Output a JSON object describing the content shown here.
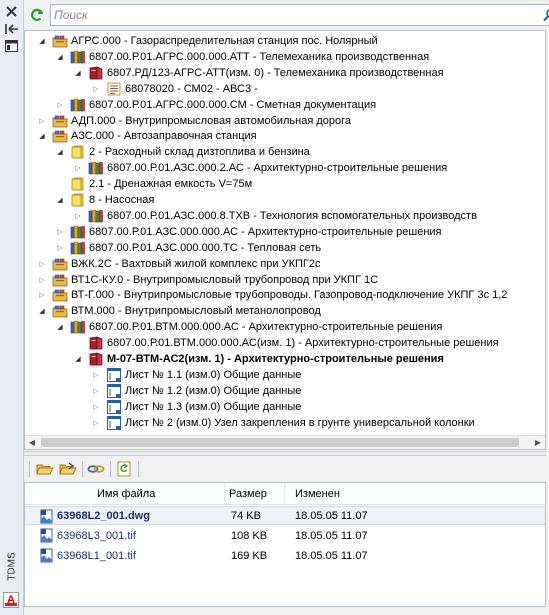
{
  "left_strip": {
    "vertical_label": "TDMS",
    "bottom_badge": "A"
  },
  "search": {
    "placeholder": "Поиск"
  },
  "tree": [
    {
      "level": 0,
      "twist": "open",
      "icon": "folder-stack-icon",
      "label": "АГРС.000 - Газораспределительная станция пос. Нолярный"
    },
    {
      "level": 1,
      "twist": "open",
      "icon": "books-icon",
      "label": "6807.00.Р.01.АГРС.000.000.АТТ - Телемеханика производственная"
    },
    {
      "level": 2,
      "twist": "open",
      "icon": "red-book-icon",
      "label": "6807.РД/123-АГРС-АТТ(изм. 0) - Телемеханика производственная"
    },
    {
      "level": 3,
      "twist": "closed",
      "icon": "doc-yellow-icon",
      "label": "68078020 - СМ02 - АВС3 -"
    },
    {
      "level": 1,
      "twist": "closed",
      "icon": "books-icon",
      "label": "6807.00.Р.01.АГРС.000.000.СМ - Сметная документация"
    },
    {
      "level": 0,
      "twist": "closed",
      "icon": "folder-stack-icon",
      "label": "АДП.000 - Внутрипромысловая автомобильная дорога"
    },
    {
      "level": 0,
      "twist": "open",
      "icon": "folder-stack-icon",
      "label": "АЗС.000 - Автозаправочная станция"
    },
    {
      "level": 1,
      "twist": "open",
      "icon": "yellow-folder-icon",
      "label": "2 - Расходный склад дизтоплива и бензина"
    },
    {
      "level": 2,
      "twist": "closed",
      "icon": "books-icon",
      "label": "6807.00.Р.01.АЗС.000.2.АС - Архитектурно-строительные решения"
    },
    {
      "level": 1,
      "twist": "none",
      "icon": "yellow-folder-icon",
      "label": "2.1 - Дренажная емкость V=75м"
    },
    {
      "level": 1,
      "twist": "open",
      "icon": "yellow-folder-icon",
      "label": "8 - Насосная"
    },
    {
      "level": 2,
      "twist": "closed",
      "icon": "books-icon",
      "label": "6807.00.Р.01.АЗС.000.8.ТХВ - Технология вспомогательных производств"
    },
    {
      "level": 1,
      "twist": "closed",
      "icon": "books-icon",
      "label": "6807.00.Р.01.АЗС.000.000.АС - Архитектурно-строительные решения"
    },
    {
      "level": 1,
      "twist": "closed",
      "icon": "books-icon",
      "label": "6807.00.Р.01.АЗС.000.000.ТС - Тепловая сеть"
    },
    {
      "level": 0,
      "twist": "closed",
      "icon": "folder-stack-icon",
      "label": "ВЖК.2С - Вахтовый жилой комплекс при УКПГ2с"
    },
    {
      "level": 0,
      "twist": "closed",
      "icon": "folder-stack-icon",
      "label": "ВТ1С-КУ.0 - Внутрипромысловый трубопровод при УКПГ 1С"
    },
    {
      "level": 0,
      "twist": "closed",
      "icon": "folder-stack-icon",
      "label": "ВТ-Г.000 - Внутрипромысловые трубопроводы. Газопровод-подключение УКПГ 3с 1,2"
    },
    {
      "level": 0,
      "twist": "open",
      "icon": "folder-stack-icon",
      "label": "ВТМ.000 - Внутрипромысловый метанолопровод"
    },
    {
      "level": 1,
      "twist": "open",
      "icon": "books-icon",
      "label": "6807.00.Р.01.ВТМ.000.000.АС - Архитектурно-строительные решения"
    },
    {
      "level": 2,
      "twist": "none",
      "icon": "red-book-icon",
      "label": "6807.00.Р.01.ВТМ.000.000.АС(изм. 1) - Архитектурно-строительные решения"
    },
    {
      "level": 2,
      "twist": "open",
      "icon": "red-book-icon",
      "label": "М-07-ВТМ-АС2(изм. 1) - Архитектурно-строительные решения",
      "selected": true
    },
    {
      "level": 3,
      "twist": "closed",
      "icon": "blue-sheet-icon",
      "label": "Лист № 1.1 (изм.0) Общие данные"
    },
    {
      "level": 3,
      "twist": "closed",
      "icon": "blue-sheet-icon",
      "label": "Лист № 1.2 (изм.0) Общие данные"
    },
    {
      "level": 3,
      "twist": "closed",
      "icon": "blue-sheet-icon",
      "label": "Лист № 1.3 (изм.0) Общие данные"
    },
    {
      "level": 3,
      "twist": "closed",
      "icon": "blue-sheet-icon",
      "label": "Лист № 2 (изм.0) Узел закрепления в грунте универсальной колонки"
    }
  ],
  "file_list": {
    "columns": {
      "name": "Имя файла",
      "size": "Размер",
      "modified": "Изменен"
    },
    "rows": [
      {
        "name": "63968L2_001.dwg",
        "size": "74 KB",
        "modified": "18.05.05 11.07",
        "selected": true
      },
      {
        "name": "63968L3_001.tif",
        "size": "108 KB",
        "modified": "18.05.05 11.07"
      },
      {
        "name": "63968L1_001.tif",
        "size": "169 KB",
        "modified": "18.05.05 11.07"
      }
    ]
  }
}
